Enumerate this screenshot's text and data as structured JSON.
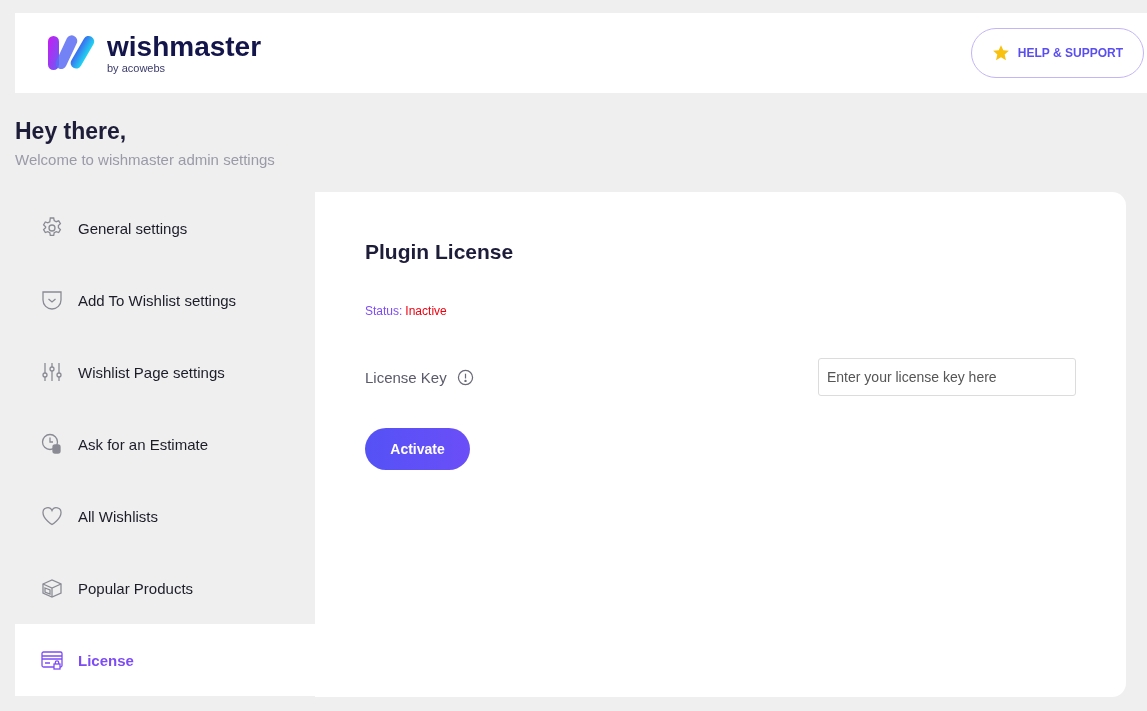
{
  "header": {
    "brand": "wishmaster",
    "byline": "by acowebs",
    "help_button": "HELP & SUPPORT"
  },
  "greeting": {
    "title": "Hey there,",
    "subtitle": "Welcome to wishmaster admin settings"
  },
  "sidebar": {
    "items": [
      {
        "label": "General settings",
        "kind": "gear",
        "selected": false
      },
      {
        "label": "Add To Wishlist settings",
        "kind": "pocket",
        "selected": false
      },
      {
        "label": "Wishlist Page settings",
        "kind": "sliders",
        "selected": false
      },
      {
        "label": "Ask for an Estimate",
        "kind": "clock",
        "selected": false
      },
      {
        "label": "All Wishlists",
        "kind": "heart",
        "selected": false
      },
      {
        "label": "Popular Products",
        "kind": "box",
        "selected": false
      },
      {
        "label": "License",
        "kind": "card",
        "selected": true
      }
    ]
  },
  "panel": {
    "title": "Plugin License",
    "status_label": "Status:",
    "status_value": "Inactive",
    "field_label": "License Key",
    "placeholder": "Enter your license key here",
    "button": "Activate"
  }
}
